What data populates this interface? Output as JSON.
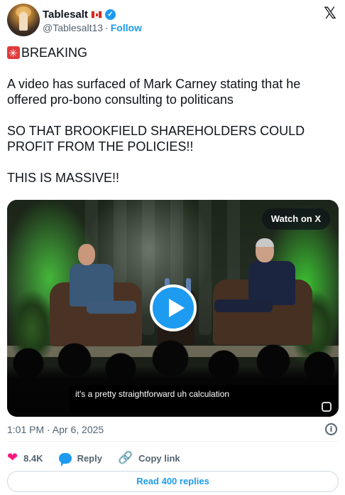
{
  "author": {
    "name": "Tablesalt",
    "handle": "@Tablesalt13",
    "separator": "·",
    "follow_label": "Follow",
    "flag_icon": "canada-flag-icon",
    "verified_icon": "verified-badge-icon"
  },
  "platform_icon": "x-logo-icon",
  "tweet": {
    "text": "BREAKING\n\nA video has surfaced of Mark Carney stating that he offered pro-bono consulting to politicans\n\nSO THAT BROOKFIELD SHAREHOLDERS COULD PROFIT FROM THE POLICIES!!\n\nTHIS IS MASSIVE!!",
    "emoji_icon": "rotating-light-icon"
  },
  "video": {
    "watch_label": "Watch on X",
    "caption": "it's a pretty straightforward uh calculation",
    "play_icon": "play-icon"
  },
  "meta": {
    "timestamp": "1:01 PM · Apr 6, 2025"
  },
  "actions": {
    "likes": "8.4K",
    "reply_label": "Reply",
    "copy_label": "Copy link"
  },
  "read_replies_label": "Read 400 replies",
  "colors": {
    "accent": "#1d9bf0",
    "like": "#f91880",
    "text": "#0f1419",
    "muted": "#536471"
  }
}
